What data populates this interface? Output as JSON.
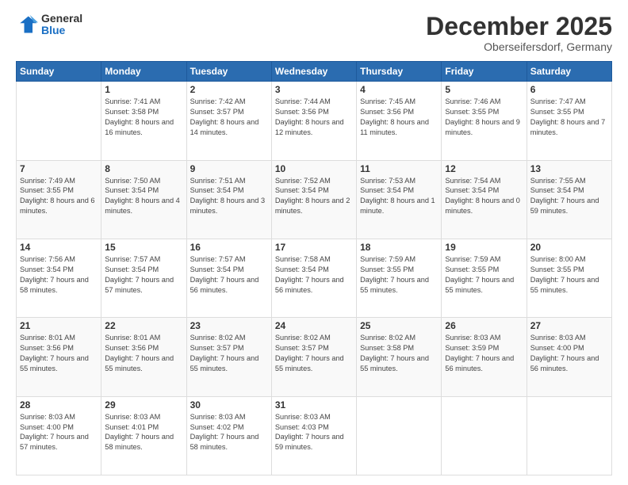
{
  "logo": {
    "general": "General",
    "blue": "Blue"
  },
  "header": {
    "month": "December 2025",
    "location": "Oberseifersdorf, Germany"
  },
  "weekdays": [
    "Sunday",
    "Monday",
    "Tuesday",
    "Wednesday",
    "Thursday",
    "Friday",
    "Saturday"
  ],
  "weeks": [
    [
      {
        "day": "",
        "sunrise": "",
        "sunset": "",
        "daylight": ""
      },
      {
        "day": "1",
        "sunrise": "Sunrise: 7:41 AM",
        "sunset": "Sunset: 3:58 PM",
        "daylight": "Daylight: 8 hours and 16 minutes."
      },
      {
        "day": "2",
        "sunrise": "Sunrise: 7:42 AM",
        "sunset": "Sunset: 3:57 PM",
        "daylight": "Daylight: 8 hours and 14 minutes."
      },
      {
        "day": "3",
        "sunrise": "Sunrise: 7:44 AM",
        "sunset": "Sunset: 3:56 PM",
        "daylight": "Daylight: 8 hours and 12 minutes."
      },
      {
        "day": "4",
        "sunrise": "Sunrise: 7:45 AM",
        "sunset": "Sunset: 3:56 PM",
        "daylight": "Daylight: 8 hours and 11 minutes."
      },
      {
        "day": "5",
        "sunrise": "Sunrise: 7:46 AM",
        "sunset": "Sunset: 3:55 PM",
        "daylight": "Daylight: 8 hours and 9 minutes."
      },
      {
        "day": "6",
        "sunrise": "Sunrise: 7:47 AM",
        "sunset": "Sunset: 3:55 PM",
        "daylight": "Daylight: 8 hours and 7 minutes."
      }
    ],
    [
      {
        "day": "7",
        "sunrise": "Sunrise: 7:49 AM",
        "sunset": "Sunset: 3:55 PM",
        "daylight": "Daylight: 8 hours and 6 minutes."
      },
      {
        "day": "8",
        "sunrise": "Sunrise: 7:50 AM",
        "sunset": "Sunset: 3:54 PM",
        "daylight": "Daylight: 8 hours and 4 minutes."
      },
      {
        "day": "9",
        "sunrise": "Sunrise: 7:51 AM",
        "sunset": "Sunset: 3:54 PM",
        "daylight": "Daylight: 8 hours and 3 minutes."
      },
      {
        "day": "10",
        "sunrise": "Sunrise: 7:52 AM",
        "sunset": "Sunset: 3:54 PM",
        "daylight": "Daylight: 8 hours and 2 minutes."
      },
      {
        "day": "11",
        "sunrise": "Sunrise: 7:53 AM",
        "sunset": "Sunset: 3:54 PM",
        "daylight": "Daylight: 8 hours and 1 minute."
      },
      {
        "day": "12",
        "sunrise": "Sunrise: 7:54 AM",
        "sunset": "Sunset: 3:54 PM",
        "daylight": "Daylight: 8 hours and 0 minutes."
      },
      {
        "day": "13",
        "sunrise": "Sunrise: 7:55 AM",
        "sunset": "Sunset: 3:54 PM",
        "daylight": "Daylight: 7 hours and 59 minutes."
      }
    ],
    [
      {
        "day": "14",
        "sunrise": "Sunrise: 7:56 AM",
        "sunset": "Sunset: 3:54 PM",
        "daylight": "Daylight: 7 hours and 58 minutes."
      },
      {
        "day": "15",
        "sunrise": "Sunrise: 7:57 AM",
        "sunset": "Sunset: 3:54 PM",
        "daylight": "Daylight: 7 hours and 57 minutes."
      },
      {
        "day": "16",
        "sunrise": "Sunrise: 7:57 AM",
        "sunset": "Sunset: 3:54 PM",
        "daylight": "Daylight: 7 hours and 56 minutes."
      },
      {
        "day": "17",
        "sunrise": "Sunrise: 7:58 AM",
        "sunset": "Sunset: 3:54 PM",
        "daylight": "Daylight: 7 hours and 56 minutes."
      },
      {
        "day": "18",
        "sunrise": "Sunrise: 7:59 AM",
        "sunset": "Sunset: 3:55 PM",
        "daylight": "Daylight: 7 hours and 55 minutes."
      },
      {
        "day": "19",
        "sunrise": "Sunrise: 7:59 AM",
        "sunset": "Sunset: 3:55 PM",
        "daylight": "Daylight: 7 hours and 55 minutes."
      },
      {
        "day": "20",
        "sunrise": "Sunrise: 8:00 AM",
        "sunset": "Sunset: 3:55 PM",
        "daylight": "Daylight: 7 hours and 55 minutes."
      }
    ],
    [
      {
        "day": "21",
        "sunrise": "Sunrise: 8:01 AM",
        "sunset": "Sunset: 3:56 PM",
        "daylight": "Daylight: 7 hours and 55 minutes."
      },
      {
        "day": "22",
        "sunrise": "Sunrise: 8:01 AM",
        "sunset": "Sunset: 3:56 PM",
        "daylight": "Daylight: 7 hours and 55 minutes."
      },
      {
        "day": "23",
        "sunrise": "Sunrise: 8:02 AM",
        "sunset": "Sunset: 3:57 PM",
        "daylight": "Daylight: 7 hours and 55 minutes."
      },
      {
        "day": "24",
        "sunrise": "Sunrise: 8:02 AM",
        "sunset": "Sunset: 3:57 PM",
        "daylight": "Daylight: 7 hours and 55 minutes."
      },
      {
        "day": "25",
        "sunrise": "Sunrise: 8:02 AM",
        "sunset": "Sunset: 3:58 PM",
        "daylight": "Daylight: 7 hours and 55 minutes."
      },
      {
        "day": "26",
        "sunrise": "Sunrise: 8:03 AM",
        "sunset": "Sunset: 3:59 PM",
        "daylight": "Daylight: 7 hours and 56 minutes."
      },
      {
        "day": "27",
        "sunrise": "Sunrise: 8:03 AM",
        "sunset": "Sunset: 4:00 PM",
        "daylight": "Daylight: 7 hours and 56 minutes."
      }
    ],
    [
      {
        "day": "28",
        "sunrise": "Sunrise: 8:03 AM",
        "sunset": "Sunset: 4:00 PM",
        "daylight": "Daylight: 7 hours and 57 minutes."
      },
      {
        "day": "29",
        "sunrise": "Sunrise: 8:03 AM",
        "sunset": "Sunset: 4:01 PM",
        "daylight": "Daylight: 7 hours and 58 minutes."
      },
      {
        "day": "30",
        "sunrise": "Sunrise: 8:03 AM",
        "sunset": "Sunset: 4:02 PM",
        "daylight": "Daylight: 7 hours and 58 minutes."
      },
      {
        "day": "31",
        "sunrise": "Sunrise: 8:03 AM",
        "sunset": "Sunset: 4:03 PM",
        "daylight": "Daylight: 7 hours and 59 minutes."
      },
      {
        "day": "",
        "sunrise": "",
        "sunset": "",
        "daylight": ""
      },
      {
        "day": "",
        "sunrise": "",
        "sunset": "",
        "daylight": ""
      },
      {
        "day": "",
        "sunrise": "",
        "sunset": "",
        "daylight": ""
      }
    ]
  ]
}
